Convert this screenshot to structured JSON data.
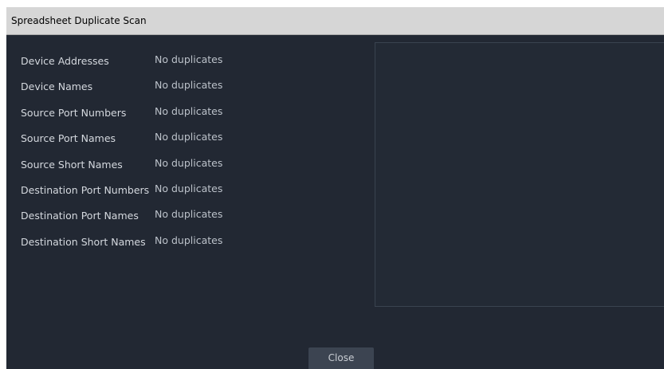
{
  "window": {
    "title": "Spreadsheet Duplicate Scan"
  },
  "scan": {
    "rows": [
      {
        "label": "Device Addresses",
        "value": "No duplicates"
      },
      {
        "label": "Device Names",
        "value": "No duplicates"
      },
      {
        "label": "Source Port Numbers",
        "value": "No duplicates"
      },
      {
        "label": "Source Port Names",
        "value": "No duplicates"
      },
      {
        "label": "Source Short Names",
        "value": "No duplicates"
      },
      {
        "label": "Destination Port Numbers",
        "value": "No duplicates"
      },
      {
        "label": "Destination Port Names",
        "value": "No duplicates"
      },
      {
        "label": "Destination Short Names",
        "value": "No duplicates"
      }
    ]
  },
  "footer": {
    "close_label": "Close"
  },
  "colors": {
    "window_background": "#222833",
    "titlebar_background": "#d6d6d6",
    "button_background": "#3c4451",
    "text": "#d4d8de"
  }
}
